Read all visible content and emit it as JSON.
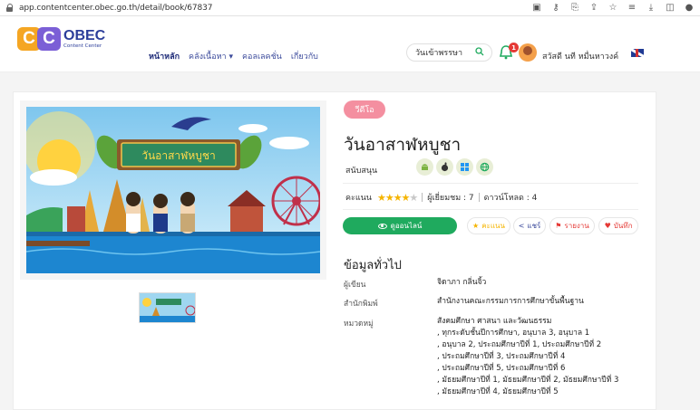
{
  "browser": {
    "url": "app.contentcenter.obec.go.th/detail/book/67837"
  },
  "logo": {
    "letters": "CC",
    "name": "OBEC",
    "sub": "Content Center"
  },
  "nav": {
    "items": [
      "หน้าหลัก",
      "คลังเนื้อหา",
      "คอลเลคชั่น",
      "เกี่ยวกับ"
    ],
    "search_value": "วันเข้าพรรษา",
    "notifications": "1",
    "user_name": "สวัสดี นที หมื่นหาวงค์"
  },
  "detail": {
    "type_tag": "วีดีโอ",
    "title": "วันอาสาฬหบูชา",
    "support_label": "สนับสนุน",
    "rating_label": "คะแนน",
    "rating": 4,
    "viewers_label": "ผู้เยี่ยมชม : 7",
    "downloads_label": "ดาวน์โหลด : 4",
    "online_button": "ดูออนไลน์",
    "score_button": "คะแนน",
    "share_button": "แชร์",
    "report_button": "รายงาน",
    "save_button": "บันทึก",
    "general_heading": "ข้อมูลทั่วไป",
    "author_label": "ผู้เขียน",
    "author": "จิดาภา กลิ่นจิ้ว",
    "publisher_label": "สำนักพิมพ์",
    "publisher": "สำนักงานคณะกรรมการการศึกษาขั้นพื้นฐาน",
    "category_label": "หมวดหมู่",
    "category_lines": [
      "สังคมศึกษา ศาสนา และวัฒนธรรม",
      ", ทุกระดับชั้นปีการศึกษา, อนุบาล 3, อนุบาล 1",
      ", อนุบาล 2, ประถมศึกษาปีที่ 1, ประถมศึกษาปีที่ 2",
      ", ประถมศึกษาปีที่ 3, ประถมศึกษาปีที่ 4",
      ", ประถมศึกษาปีที่ 5, ประถมศึกษาปีที่ 6",
      ", มัธยมศึกษาปีที่ 1, มัธยมศึกษาปีที่ 2, มัธยมศึกษาปีที่ 3",
      ", มัธยมศึกษาปีที่ 4, มัธยมศึกษาปีที่ 5"
    ],
    "cover_sign_text": "วันอาสาฬหบูชา"
  },
  "colors": {
    "primary": "#3b4a9b",
    "success": "#1faa5e",
    "tag": "#f48fa0",
    "star": "#f5b400"
  }
}
